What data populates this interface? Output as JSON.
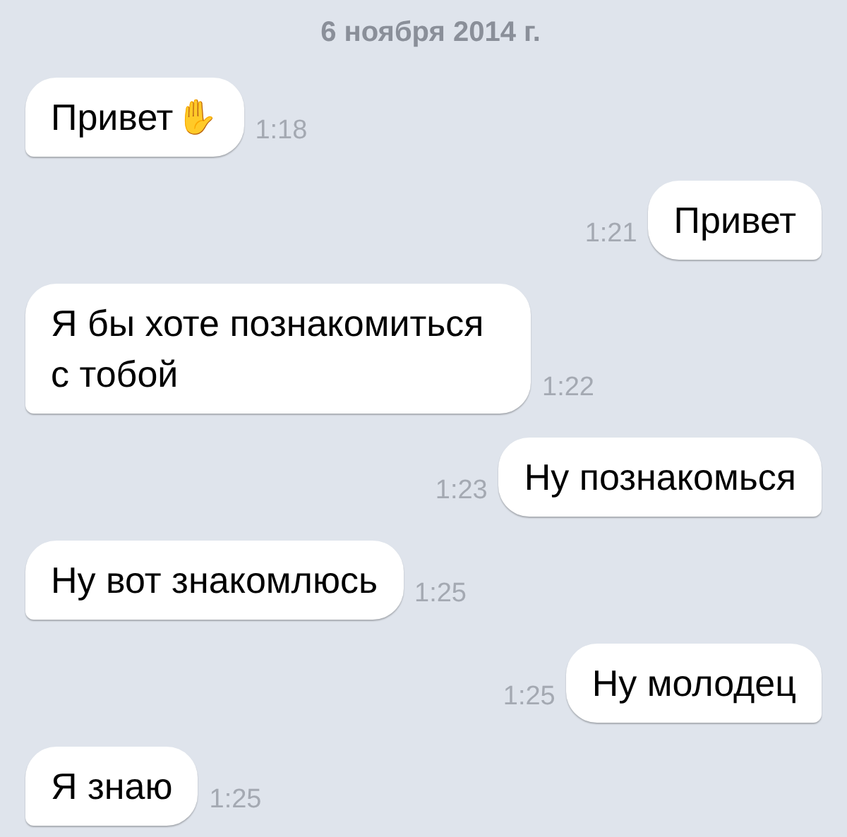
{
  "date": "6 ноября 2014 г.",
  "messages": [
    {
      "kind": "incoming",
      "text": "Привет",
      "emoji": "✋",
      "time": "1:18"
    },
    {
      "kind": "outgoing",
      "text": "Привет",
      "time": "1:21"
    },
    {
      "kind": "incoming",
      "text": "Я бы хоте познакомиться с тобой",
      "time": "1:22"
    },
    {
      "kind": "outgoing",
      "text": "Ну познакомься",
      "time": "1:23"
    },
    {
      "kind": "incoming",
      "text": "Ну вот знакомлюсь",
      "time": "1:25"
    },
    {
      "kind": "outgoing",
      "text": "Ну молодец",
      "time": "1:25"
    },
    {
      "kind": "incoming",
      "text": "Я знаю",
      "time": "1:25"
    }
  ]
}
